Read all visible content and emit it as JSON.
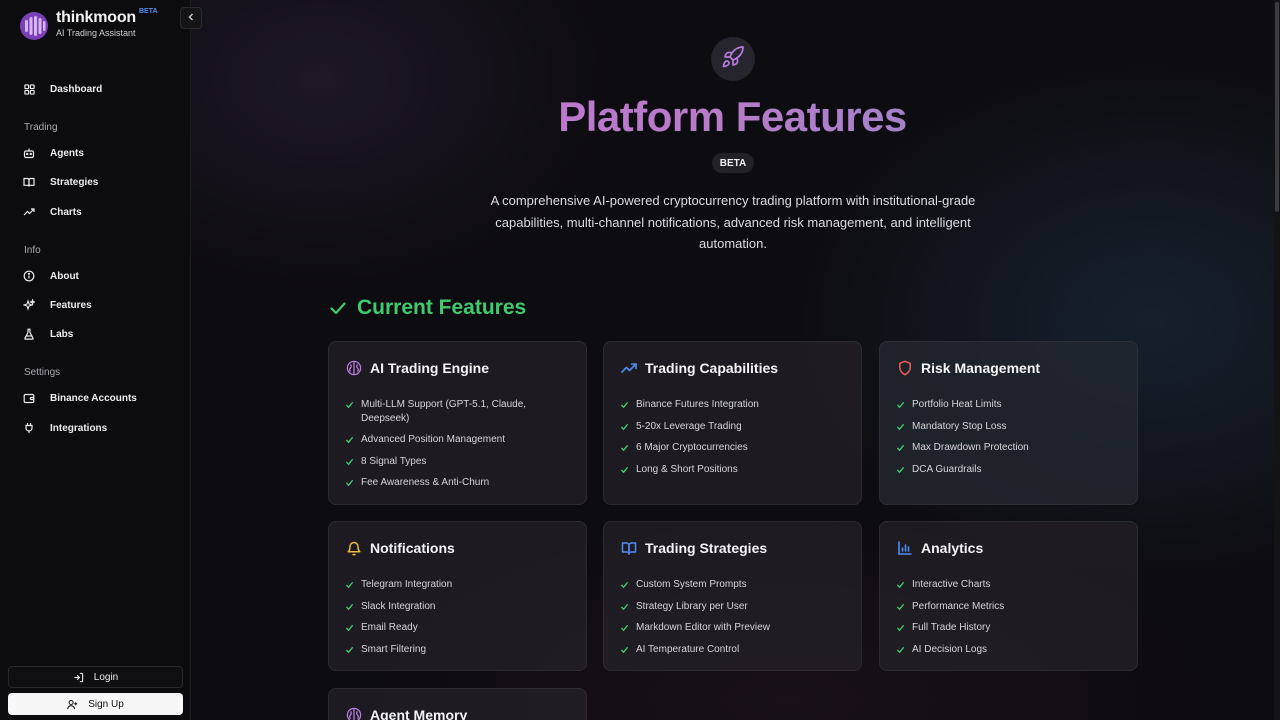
{
  "brand": {
    "name": "thinkmoon",
    "badge": "BETA",
    "subtitle": "AI Trading Assistant"
  },
  "sidebar": {
    "dashboard": {
      "label": "Dashboard",
      "icon": "grid-icon"
    },
    "sections": [
      {
        "title": "Trading",
        "items": [
          {
            "label": "Agents",
            "icon": "bot-icon"
          },
          {
            "label": "Strategies",
            "icon": "book-icon"
          },
          {
            "label": "Charts",
            "icon": "trending-up-icon"
          }
        ]
      },
      {
        "title": "Info",
        "items": [
          {
            "label": "About",
            "icon": "info-icon"
          },
          {
            "label": "Features",
            "icon": "sparkles-icon"
          },
          {
            "label": "Labs",
            "icon": "flask-icon"
          }
        ]
      },
      {
        "title": "Settings",
        "items": [
          {
            "label": "Binance Accounts",
            "icon": "wallet-icon"
          },
          {
            "label": "Integrations",
            "icon": "plug-icon"
          }
        ]
      }
    ],
    "login_label": "Login",
    "signup_label": "Sign Up"
  },
  "hero": {
    "icon": "rocket-icon",
    "title": "Platform Features",
    "badge": "BETA",
    "description": "A comprehensive AI-powered cryptocurrency trading platform with institutional-grade capabilities, multi-channel notifications, advanced risk management, and intelligent automation."
  },
  "current_features": {
    "title": "Current Features",
    "cards": [
      {
        "title": "AI Trading Engine",
        "icon": "brain-icon",
        "items": [
          "Multi-LLM Support (GPT-5.1, Claude, Deepseek)",
          "Advanced Position Management",
          "8 Signal Types",
          "Fee Awareness & Anti-Churn"
        ]
      },
      {
        "title": "Trading Capabilities",
        "icon": "trending-up-icon",
        "items": [
          "Binance Futures Integration",
          "5-20x Leverage Trading",
          "6 Major Cryptocurrencies",
          "Long & Short Positions"
        ]
      },
      {
        "title": "Risk Management",
        "icon": "shield-icon",
        "items": [
          "Portfolio Heat Limits",
          "Mandatory Stop Loss",
          "Max Drawdown Protection",
          "DCA Guardrails"
        ]
      },
      {
        "title": "Notifications",
        "icon": "bell-icon",
        "items": [
          "Telegram Integration",
          "Slack Integration",
          "Email Ready",
          "Smart Filtering"
        ]
      },
      {
        "title": "Trading Strategies",
        "icon": "book-open-icon",
        "items": [
          "Custom System Prompts",
          "Strategy Library per User",
          "Markdown Editor with Preview",
          "AI Temperature Control"
        ]
      },
      {
        "title": "Analytics",
        "icon": "bar-chart-icon",
        "items": [
          "Interactive Charts",
          "Performance Metrics",
          "Full Trade History",
          "AI Decision Logs"
        ]
      },
      {
        "title": "Agent Memory",
        "icon": "brain-icon",
        "items": []
      }
    ]
  },
  "colors": {
    "accent_green": "#3ecb6e",
    "brand_purple": "#a35ed4",
    "icon_purple": "#b97be0",
    "icon_blue": "#4f8df5",
    "icon_red": "#ef5a5a",
    "icon_yellow": "#e8b93a"
  }
}
